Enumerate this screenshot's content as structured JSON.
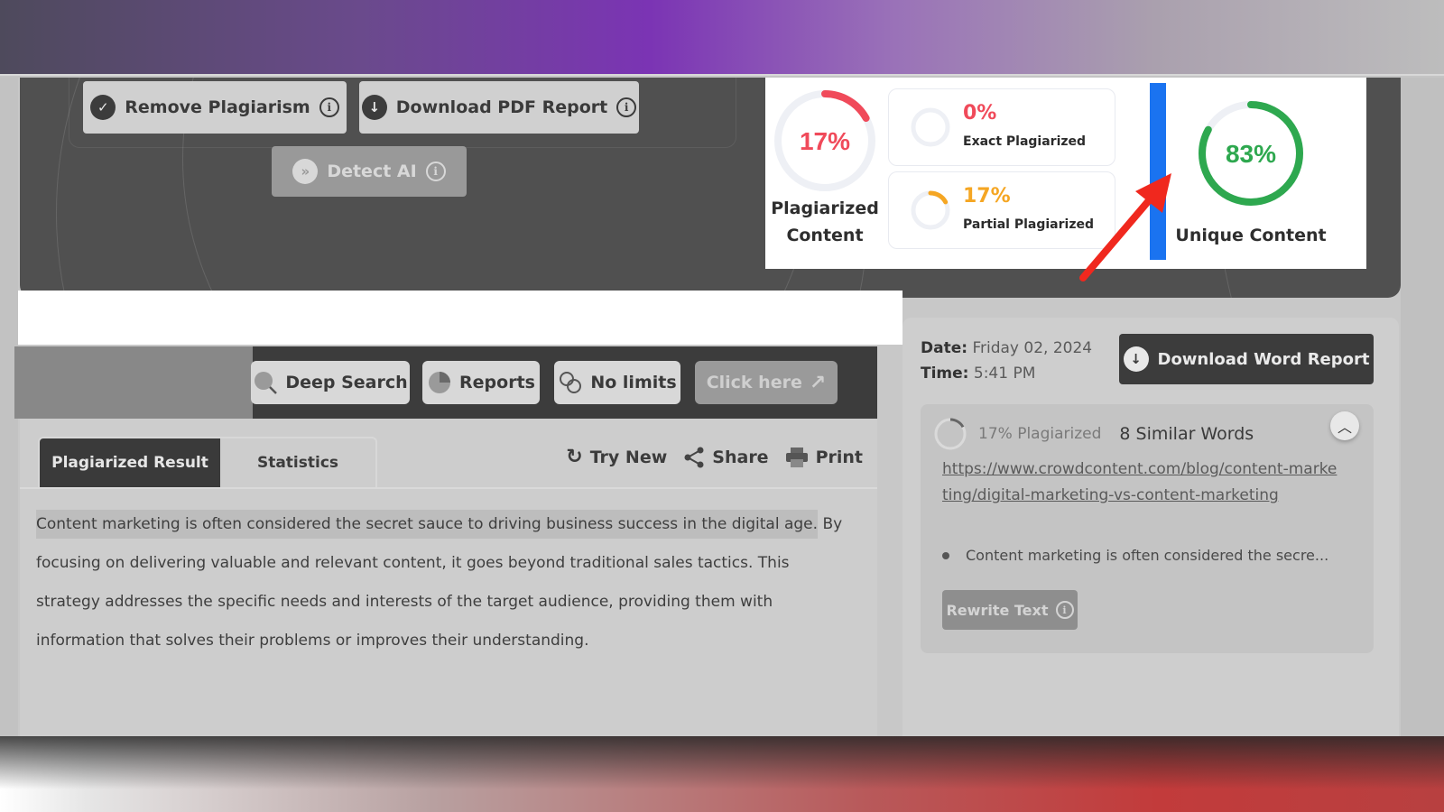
{
  "hero": {
    "remove_plagiarism": "Remove Plagiarism",
    "download_pdf": "Download PDF Report",
    "detect_ai": "Detect AI"
  },
  "stats": {
    "plagiarized": {
      "value": "17%",
      "fraction": 0.17,
      "label_line1": "Plagiarized",
      "label_line2": "Content",
      "color": "#f04a5a"
    },
    "exact": {
      "value": "0%",
      "fraction": 0,
      "label": "Exact Plagiarized",
      "color": "#f04a5a"
    },
    "partial": {
      "value": "17%",
      "fraction": 0.17,
      "label": "Partial Plagiarized",
      "color": "#f5a623"
    },
    "unique": {
      "value": "83%",
      "fraction": 0.83,
      "label": "Unique Content",
      "color": "#2ea84f"
    },
    "track_color": "#eef0f5",
    "highlight_bar_color": "#1a73f0",
    "arrow_color": "#f0281e"
  },
  "toolbar": {
    "deep_search": "Deep Search",
    "reports": "Reports",
    "no_limits": "No limits",
    "click_here": "Click here"
  },
  "tabs": {
    "active": "Plagiarized Result",
    "inactive": "Statistics"
  },
  "actions": {
    "try_new": "Try New",
    "share": "Share",
    "print": "Print"
  },
  "content": {
    "highlighted": "Content marketing is often considered the secret sauce to driving business success in the digital age.",
    "rest": " By focusing on delivering valuable and relevant content, it goes beyond traditional sales tactics. This strategy addresses the specific needs and interests of the target audience, providing them with information that solves their problems or improves their understanding."
  },
  "report": {
    "date_label": "Date:",
    "date_value": "Friday 02, 2024",
    "time_label": "Time:",
    "time_value": "5:41 PM",
    "download_word": "Download Word Report"
  },
  "source": {
    "percent": "17% Plagiarized",
    "fraction": 0.17,
    "similar_words": "8 Similar Words",
    "url": "https://www.crowdcontent.com/blog/content-marketing/digital-marketing-vs-content-marketing",
    "snippet": "Content marketing is often considered the secre...",
    "rewrite": "Rewrite Text"
  }
}
